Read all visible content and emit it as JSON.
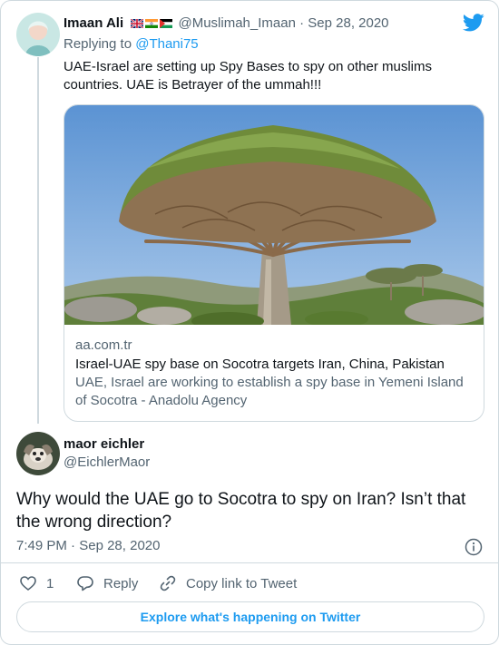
{
  "brand": {
    "icon": "twitter-bird-icon",
    "color": "#1d9bf0"
  },
  "reply_tweet": {
    "author_name": "Imaan Ali",
    "flags": [
      "uk-flag-icon",
      "india-flag-icon",
      "palestine-flag-icon"
    ],
    "handle": "@Muslimah_Imaan",
    "separator": "·",
    "date": "Sep 28, 2020",
    "replying_label": "Replying to",
    "replying_handle": "@Thani75",
    "text": "UAE-Israel are setting up Spy Bases to spy on other muslims countries. UAE is Betrayer of the ummah!!!",
    "link_card": {
      "image": "dragon-blood-tree-photo",
      "domain": "aa.com.tr",
      "title": "Israel-UAE spy base on Socotra targets Iran, China, Pakistan",
      "description": "UAE, Israel are working to establish a spy base in Yemeni Island of Socotra - Anadolu Agency"
    }
  },
  "main_tweet": {
    "author_name": "maor eichler",
    "handle": "@EichlerMaor",
    "text": "Why would the UAE go to Socotra to spy on Iran? Isn’t that the wrong direction?",
    "time": "7:49 PM",
    "separator": "·",
    "date": "Sep 28, 2020",
    "info_icon": "info-icon"
  },
  "actions": {
    "like_count": "1",
    "reply_label": "Reply",
    "copy_link_label": "Copy link to Tweet"
  },
  "footer": {
    "explore_label": "Explore what's happening on Twitter"
  },
  "colors": {
    "text": "#0f1419",
    "muted": "#536471",
    "accent": "#1d9bf0",
    "border": "#cfd9de"
  }
}
